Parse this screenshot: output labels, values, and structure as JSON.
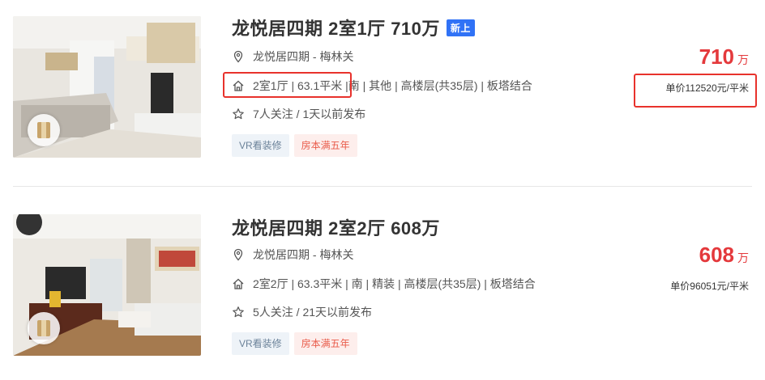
{
  "listings": [
    {
      "title": "龙悦居四期 2室1厅 710万",
      "new_badge": "新上",
      "location": "龙悦居四期 - 梅林关",
      "house_info_highlighted": "2室1厅 | 63.1平米 |",
      "house_info_rest": " 南 | 其他 | 高楼层(共35层) | 板塔结合",
      "follow_info": "7人关注 / 1天以前发布",
      "tags": [
        "VR看装修",
        "房本满五年"
      ],
      "price_value": "710",
      "price_unit": "万",
      "unit_price": "单价112520元/平米"
    },
    {
      "title": "龙悦居四期 2室2厅 608万",
      "location": "龙悦居四期 - 梅林关",
      "house_info": "2室2厅 | 63.3平米 | 南 | 精装 | 高楼层(共35层) | 板塔结合",
      "follow_info": "5人关注 / 21天以前发布",
      "tags": [
        "VR看装修",
        "房本满五年"
      ],
      "price_value": "608",
      "price_unit": "万",
      "unit_price": "单价96051元/平米"
    }
  ],
  "colors": {
    "price": "#e4393c",
    "new_badge": "#3072f6",
    "highlight_box": "#e8322c",
    "tag_vr_bg": "#eef3f8",
    "tag_tax_bg": "#fdeeec"
  },
  "icons": {
    "location": "map-pin-icon",
    "house": "house-icon",
    "follow": "star-icon",
    "vr": "vr-badge-icon"
  }
}
